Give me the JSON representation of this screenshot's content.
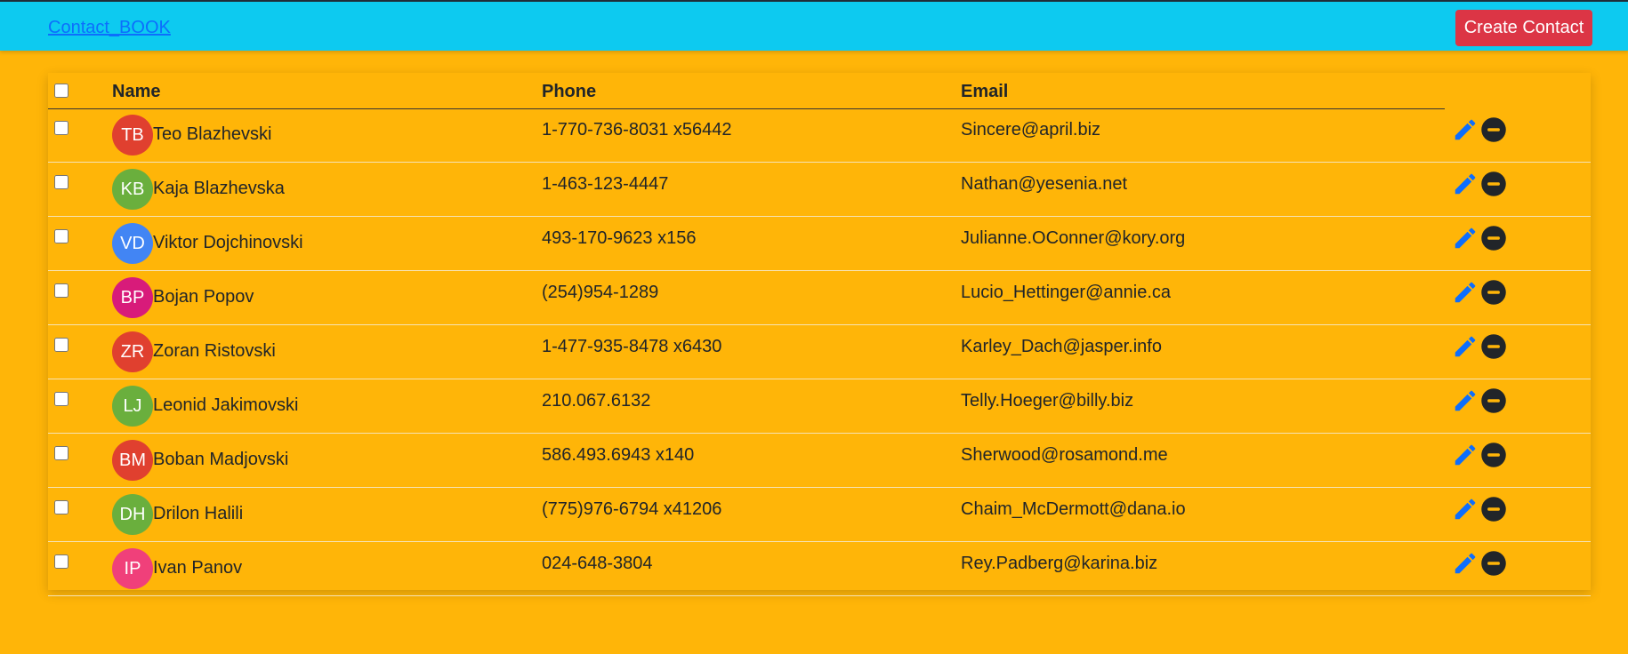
{
  "header": {
    "brand": "Contact_BOOK",
    "create_label": "Create Contact"
  },
  "table": {
    "columns": [
      "Name",
      "Phone",
      "Email"
    ]
  },
  "contacts": [
    {
      "initials": "TB",
      "name": "Teo Blazhevski",
      "phone": "1-770-736-8031 x56442",
      "email": "Sincere@april.biz",
      "color": "#e0402f"
    },
    {
      "initials": "KB",
      "name": "Kaja Blazhevska",
      "phone": "1-463-123-4447",
      "email": "Nathan@yesenia.net",
      "color": "#6aaf3d"
    },
    {
      "initials": "VD",
      "name": "Viktor Dojchinovski",
      "phone": "493-170-9623 x156",
      "email": "Julianne.OConner@kory.org",
      "color": "#4285f4"
    },
    {
      "initials": "BP",
      "name": "Bojan Popov",
      "phone": "(254)954-1289",
      "email": "Lucio_Hettinger@annie.ca",
      "color": "#d81b7a"
    },
    {
      "initials": "ZR",
      "name": "Zoran Ristovski",
      "phone": "1-477-935-8478 x6430",
      "email": "Karley_Dach@jasper.info",
      "color": "#e0402f"
    },
    {
      "initials": "LJ",
      "name": "Leonid Jakimovski",
      "phone": "210.067.6132",
      "email": "Telly.Hoeger@billy.biz",
      "color": "#6aaf3d"
    },
    {
      "initials": "BM",
      "name": "Boban Madjovski",
      "phone": "586.493.6943 x140",
      "email": "Sherwood@rosamond.me",
      "color": "#e0402f"
    },
    {
      "initials": "DH",
      "name": "Drilon Halili",
      "phone": "(775)976-6794 x41206",
      "email": "Chaim_McDermott@dana.io",
      "color": "#6aaf3d"
    },
    {
      "initials": "IP",
      "name": "Ivan Panov",
      "phone": "024-648-3804",
      "email": "Rey.Padberg@karina.biz",
      "color": "#f0407a"
    }
  ],
  "icons": {
    "edit": "pencil-icon",
    "delete": "minus-circle-icon"
  },
  "colors": {
    "background": "#ffb508",
    "navbar": "#0dcaf0",
    "create_button": "#dc3545",
    "edit_icon": "#0d6efd",
    "delete_icon": "#212529"
  }
}
